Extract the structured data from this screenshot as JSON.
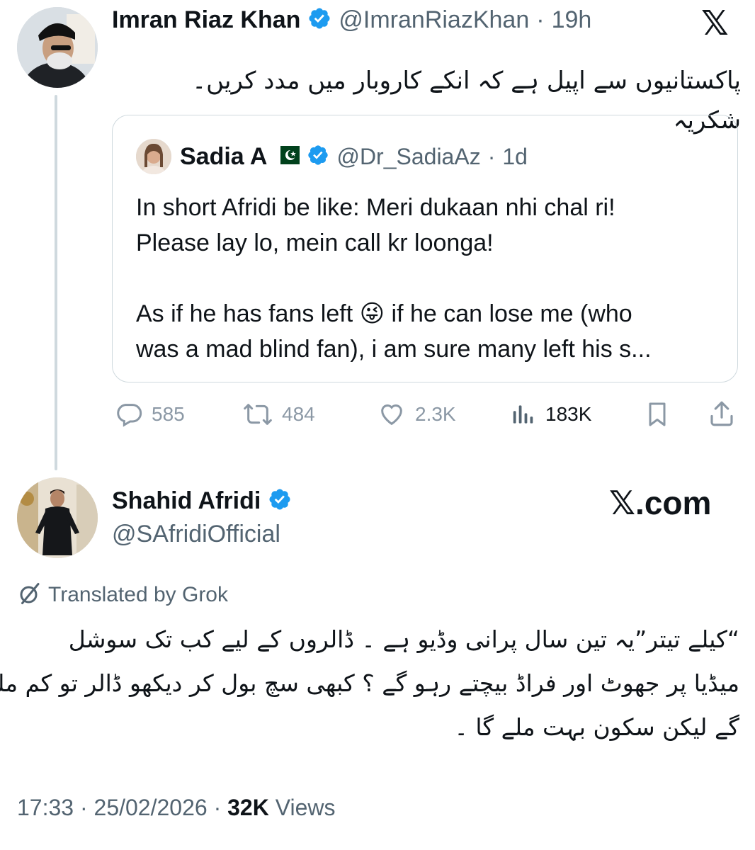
{
  "tweet": {
    "author": {
      "name": "Imran Riaz Khan",
      "handle": "@ImranRiazKhan",
      "time": "19h",
      "avatar": "avatar-man-turban-sunglasses"
    },
    "text": "پاکستانیوں سے اپیل ہے کہ انکے کاروبار میں مدد کریں۔ شکریہ",
    "x_logo": "𝕏",
    "quote": {
      "author": {
        "name": "Sadia A",
        "flag": "pakistan-flag",
        "handle": "@Dr_SadiaAz",
        "time": "1d"
      },
      "lines": [
        "In short Afridi be like: Meri dukaan nhi chal ri!",
        "Please lay lo, mein call kr loonga!",
        "As if he has fans left",
        "if he can lose me (who",
        "was a mad blind fan), i am sure many left his s..."
      ],
      "emoji": "😜"
    },
    "actions": {
      "replies": "585",
      "reposts": "484",
      "likes": "2.3K",
      "views": "183K"
    }
  },
  "reply": {
    "author": {
      "name": "Shahid Afridi",
      "handle": "@SAfridiOfficial",
      "avatar": "avatar-man-standing"
    },
    "watermark": "𝕏.com",
    "translated_label": "Translated by Grok",
    "text_lines": [
      "“کیلے تیتر”یہ تین سال پرانی وڈیو ہے ۔ ڈالروں کے لیے کب تک سوشل",
      "میڈیا پر جھوٹ اور فراڈ بیچتے رہو گے ؟ کبھی سچ بول کر دیکھو ڈالر تو کم ملیں",
      "گے لیکن سکون بہت ملے گا ۔"
    ],
    "meta": {
      "time": "17:33",
      "date": "25/02/2026",
      "views_count": "32K",
      "views_label": "Views"
    }
  },
  "colors": {
    "verified": "#1d9bf0",
    "secondary_text": "#536471",
    "action_icons": "#8b98a5",
    "border": "#cfd9de"
  }
}
